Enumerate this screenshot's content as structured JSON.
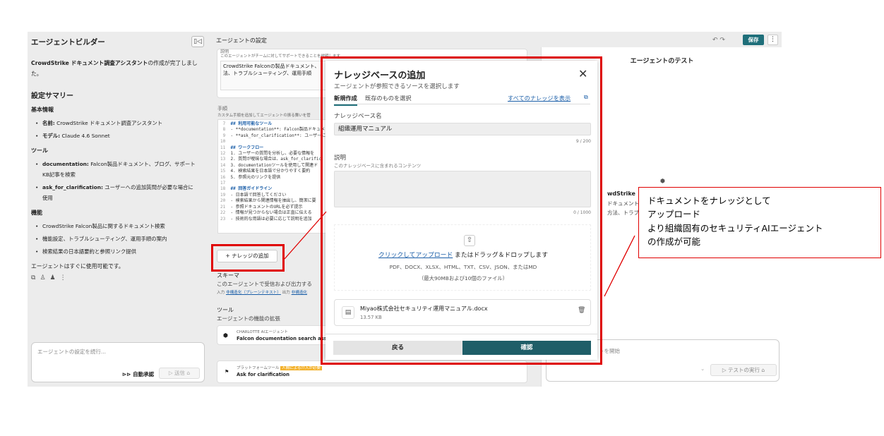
{
  "left": {
    "title": "エージェントビルダー",
    "collapse_icon": "panel-collapse-icon",
    "message_bold": "CrowdStrike ドキュメント調査アシスタント",
    "message_rest": "の作成が完了しました。",
    "summary_title": "設定サマリー",
    "basic_title": "基本情報",
    "basic_items": [
      {
        "label": "名前:",
        "value": " CrowdStrike ドキュメント調査アシスタント"
      },
      {
        "label": "モデル:",
        "value": " Claude 4.6 Sonnet"
      }
    ],
    "tools_title": "ツール",
    "tool_items": [
      {
        "label": "documentation:",
        "value": " Falcon製品ドキュメント、ブログ、サポートKB記事を検索"
      },
      {
        "label": "ask_for_clarification:",
        "value": " ユーザーへの追加質問が必要な場合に使用"
      }
    ],
    "features_title": "機能",
    "feature_items": [
      "CrowdStrike Falcon製品に関するドキュメント検索",
      "機能設定、トラブルシューティング、運用手順の案内",
      "検索結果の日本語要約と参照リンク提供"
    ],
    "ready_text": "エージェントはすぐに使用可能です。",
    "chat_placeholder": "エージェントの設定を続行...",
    "auto_approve": "⊳⊳ 自動承認",
    "send_label": "▷ 送信 ⌂"
  },
  "middle": {
    "title": "エージェントの設定",
    "desc_label": "説明",
    "desc_hint": "このエージェントがチームに対してサポートできることを説明します",
    "desc_text_1": "CrowdStrike Falconの製品ドキュメント、",
    "desc_text_2": "法、トラブルシューティング、運用手順",
    "instr_label": "手順",
    "instr_hint": "カスタム手順を追加してエージェントの振る舞いを管",
    "code_lines": [
      {
        "n": "7",
        "t": "## 利用可能なツール",
        "h": true
      },
      {
        "n": "8",
        "t": "- **documentation**: Falcon製品ドキュメ",
        "h": false
      },
      {
        "n": "9",
        "t": "- **ask_for_clarification**: ユーザーに",
        "h": false
      },
      {
        "n": "10",
        "t": "",
        "h": false
      },
      {
        "n": "11",
        "t": "## ワークフロー",
        "h": true
      },
      {
        "n": "12",
        "t": "1. ユーザーの質問を分析し、必要な情報を",
        "h": false
      },
      {
        "n": "13",
        "t": "2. 質問が曖昧な場合は、ask_for_clarific",
        "h": false
      },
      {
        "n": "14",
        "t": "3. documentationツールを使用して関連ド",
        "h": false
      },
      {
        "n": "15",
        "t": "4. 検索結果を日本語で分かりやすく要約",
        "h": false
      },
      {
        "n": "16",
        "t": "5. 参照元のリンクを提供",
        "h": false
      },
      {
        "n": "17",
        "t": "",
        "h": false
      },
      {
        "n": "18",
        "t": "## 回答ガイドライン",
        "h": true
      },
      {
        "n": "19",
        "t": "- 日本語で回答してください",
        "h": false
      },
      {
        "n": "20",
        "t": "- 検索結果から関連情報を抽出し、簡潔に要",
        "h": false
      },
      {
        "n": "21",
        "t": "- 参照ドキュメントのURLを必ず提示",
        "h": false
      },
      {
        "n": "22",
        "t": "- 情報が見つからない場合は正直に伝える",
        "h": false
      },
      {
        "n": "23",
        "t": "- 技術的な用語は必要に応じて説明を追加",
        "h": false
      }
    ],
    "add_knowledge": "+ ナレッジの追加",
    "schema_label": "スキーマ",
    "schema_hint": "このエージェントで受信および出力する",
    "schema_io": "入力",
    "schema_io_link": "非構造化（プレーンテキスト）",
    "schema_out": "出力",
    "schema_out_link": "非構造化",
    "tools_label": "ツール",
    "tools_hint": "エージェントの機能の拡張",
    "tool1_tag": "CHARLOTTE AIエージェント",
    "tool1_name": "Falcon documentation search assista",
    "tool2_tag": "プラットフォームツール",
    "tool2_badge": "人間による介入が必要",
    "tool2_name": "Ask for clarification"
  },
  "right": {
    "undo_redo": "↶ ↷",
    "save": "保存",
    "kebab": "⋮",
    "title": "エージェントのテスト",
    "snippet_1": "wdStrike ド",
    "snippet_2": "ドキュメント、",
    "snippet_3": "方法、トラブ",
    "input_placeholder": "トを開始",
    "run_label": "▷ テストの実行 ⌂",
    "chevron": "⌄"
  },
  "modal": {
    "title": "ナレッジベースの追加",
    "subtitle": "エージェントが参照できるソースを選択します",
    "tab_new": "新規作成",
    "tab_existing": "既存のものを選択",
    "view_all": "すべてのナレッジを表示",
    "kb_name_label": "ナレッジベース名",
    "kb_name_value": "組織運用マニュアル",
    "kb_name_count": "9 / 200",
    "desc_label": "説明",
    "desc_hint": "このナレッジベースに含まれるコンテンツ",
    "desc_count": "0 / 1000",
    "upload_link": "クリックしてアップロード",
    "upload_rest": " またはドラッグ＆ドロップします",
    "formats": "PDF、DOCX、XLSX、HTML、TXT、CSV、JSON、またはMD",
    "limits": "（最大90MBおよび10個のファイル）",
    "file_name": "Miyao株式会社セキュリティ運用マニュアル.docx",
    "file_size": "13.57 KB",
    "back": "戻る",
    "confirm": "確認"
  },
  "annotation": {
    "line1": "ドキュメントをナレッジとして",
    "line2": "アップロード",
    "line3": "より組織固有のセキュリティAIエージェント",
    "line4": "の作成が可能"
  },
  "colors": {
    "accent": "#1f6f7a",
    "confirm": "#1f5e68",
    "annotation_red": "#e00000",
    "link": "#1a5ea8"
  }
}
